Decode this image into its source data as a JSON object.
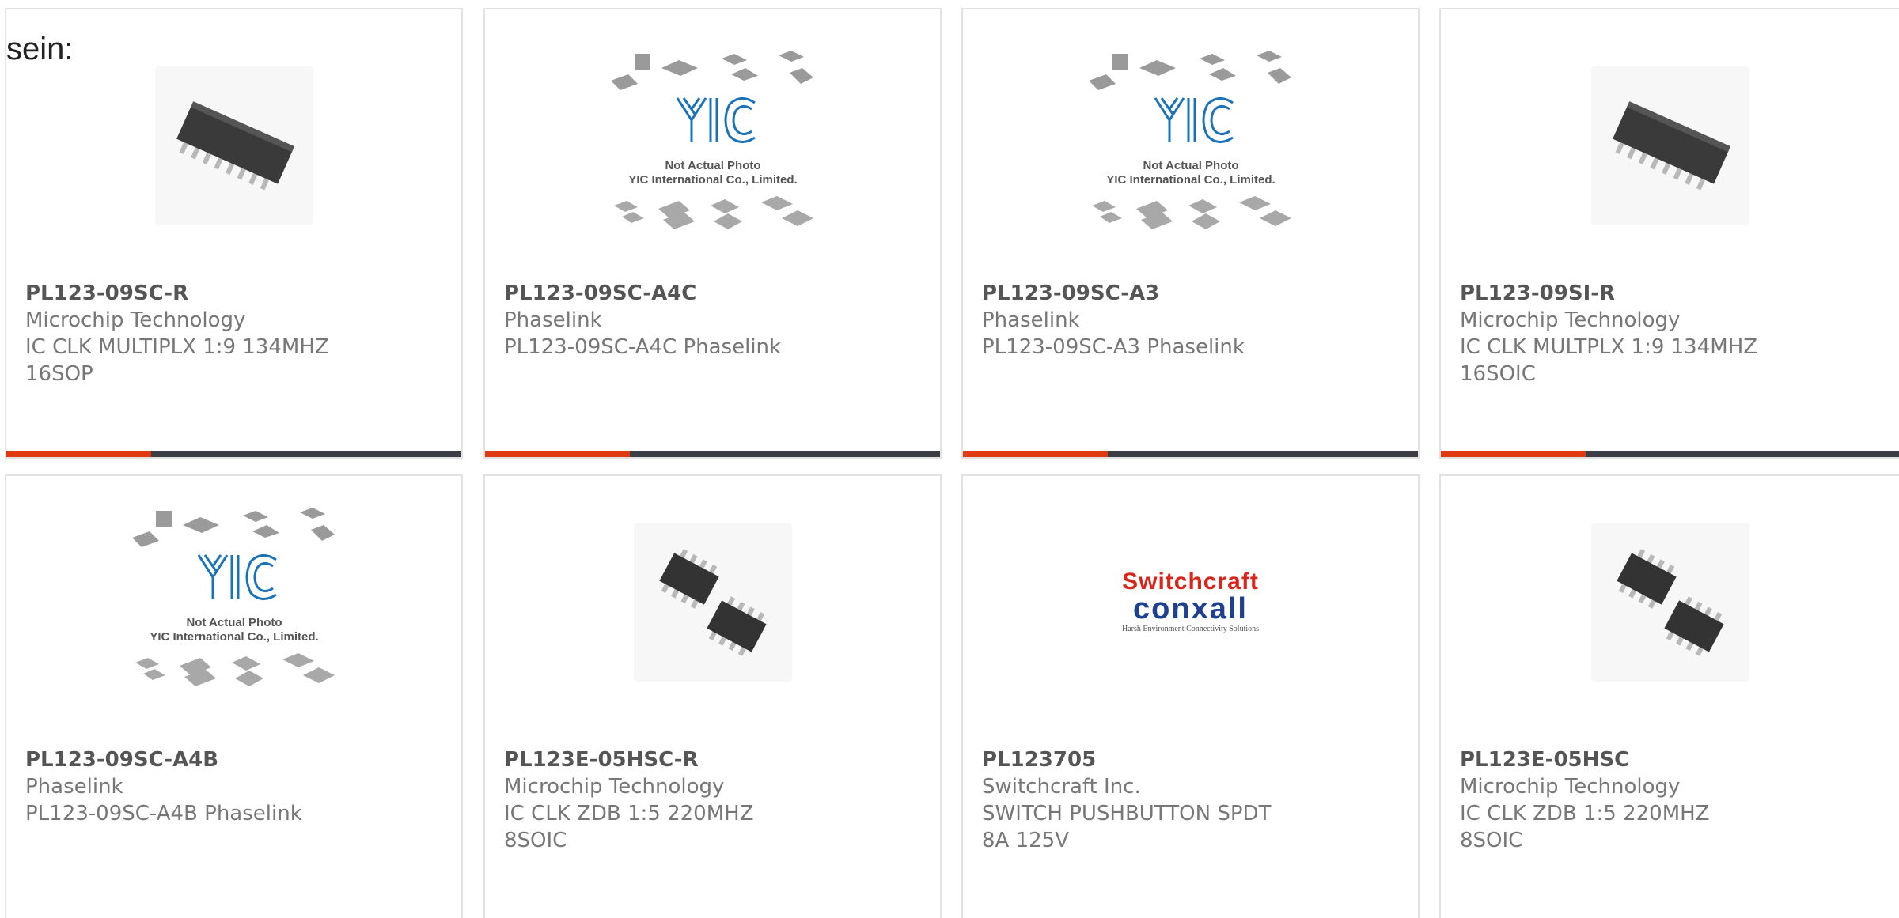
{
  "prefix_text": "sein:",
  "colors": {
    "accent": "#e03a12",
    "bar_dark": "#3b3e44",
    "border": "#e2e2e2"
  },
  "products": [
    {
      "part_number": "PL123-09SC-R",
      "manufacturer": "Microchip Technology",
      "description": "IC CLK MULTIPLX 1:9 134MHZ 16SOP",
      "image": "soic16-chip-icon"
    },
    {
      "part_number": "PL123-09SC-A4C",
      "manufacturer": "Phaselink",
      "description": "PL123-09SC-A4C Phaselink",
      "image": "yic-placeholder-icon"
    },
    {
      "part_number": "PL123-09SC-A3",
      "manufacturer": "Phaselink",
      "description": "PL123-09SC-A3 Phaselink",
      "image": "yic-placeholder-icon"
    },
    {
      "part_number": "PL123-09SI-R",
      "manufacturer": "Microchip Technology",
      "description": "IC CLK MULTPLX 1:9 134MHZ 16SOIC",
      "image": "soic16-chip-icon"
    },
    {
      "part_number": "PL123-09SC-A4B",
      "manufacturer": "Phaselink",
      "description": "PL123-09SC-A4B Phaselink",
      "image": "yic-placeholder-icon"
    },
    {
      "part_number": "PL123E-05HSC-R",
      "manufacturer": "Microchip Technology",
      "description": "IC CLK ZDB 1:5 220MHZ 8SOIC",
      "image": "soic8-chips-icon"
    },
    {
      "part_number": "PL123705",
      "manufacturer": "Switchcraft Inc.",
      "description": "SWITCH PUSHBUTTON SPDT 8A 125V",
      "image": "switchcraft-logo"
    },
    {
      "part_number": "PL123E-05HSC",
      "manufacturer": "Microchip Technology",
      "description": "IC CLK ZDB 1:5 220MHZ 8SOIC",
      "image": "soic8-chips-icon"
    }
  ],
  "yic_placeholder": {
    "line1": "Not Actual Photo",
    "line2": "YIC International Co., Limited."
  },
  "switchcraft_logo": {
    "line1": "Switchcraft",
    "line2": "conxall",
    "line3": "Harsh Environment Connectivity Solutions"
  }
}
